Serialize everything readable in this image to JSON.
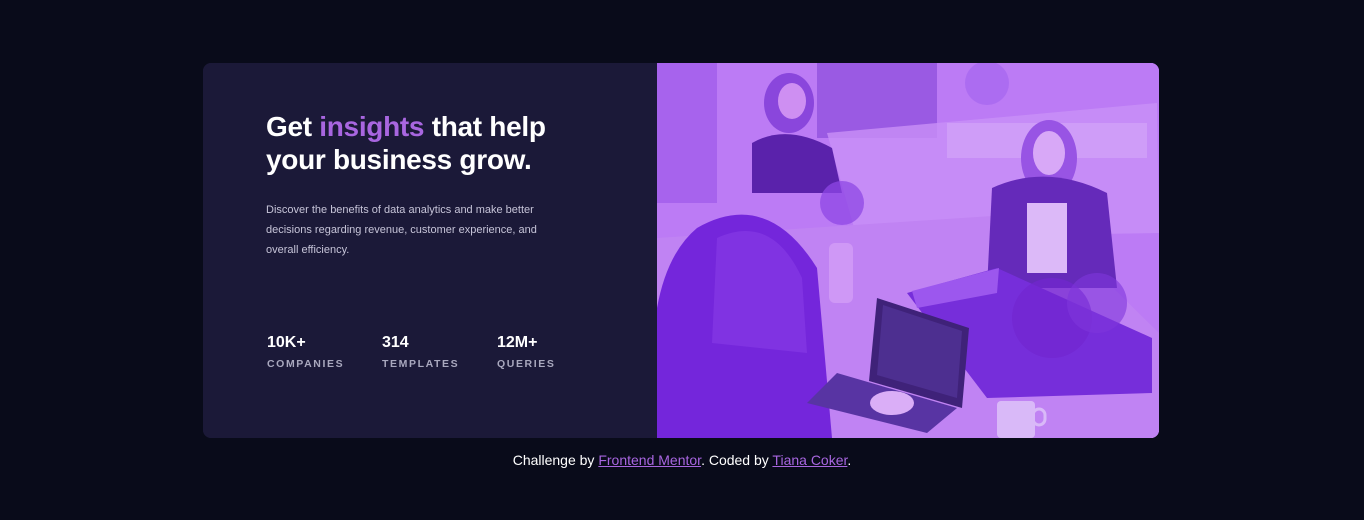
{
  "hero": {
    "headline_part1": "Get ",
    "headline_accent": "insights",
    "headline_part2": " that help your business grow.",
    "description": "Discover the benefits of data analytics and make better decisions regarding revenue, customer experience, and overall efficiency."
  },
  "stats": [
    {
      "value": "10K+",
      "label": "COMPANIES"
    },
    {
      "value": "314",
      "label": "TEMPLATES"
    },
    {
      "value": "12M+",
      "label": "QUERIES"
    }
  ],
  "footer": {
    "prefix": "Challenge by ",
    "link1": "Frontend Mentor",
    "middle": ". Coded by ",
    "link2": "Tiana Coker",
    "suffix": "."
  },
  "colors": {
    "page_background": "#090b1a",
    "card_background": "#1b1938",
    "accent": "#a866e0",
    "image_overlay": "#8b3fe8"
  }
}
